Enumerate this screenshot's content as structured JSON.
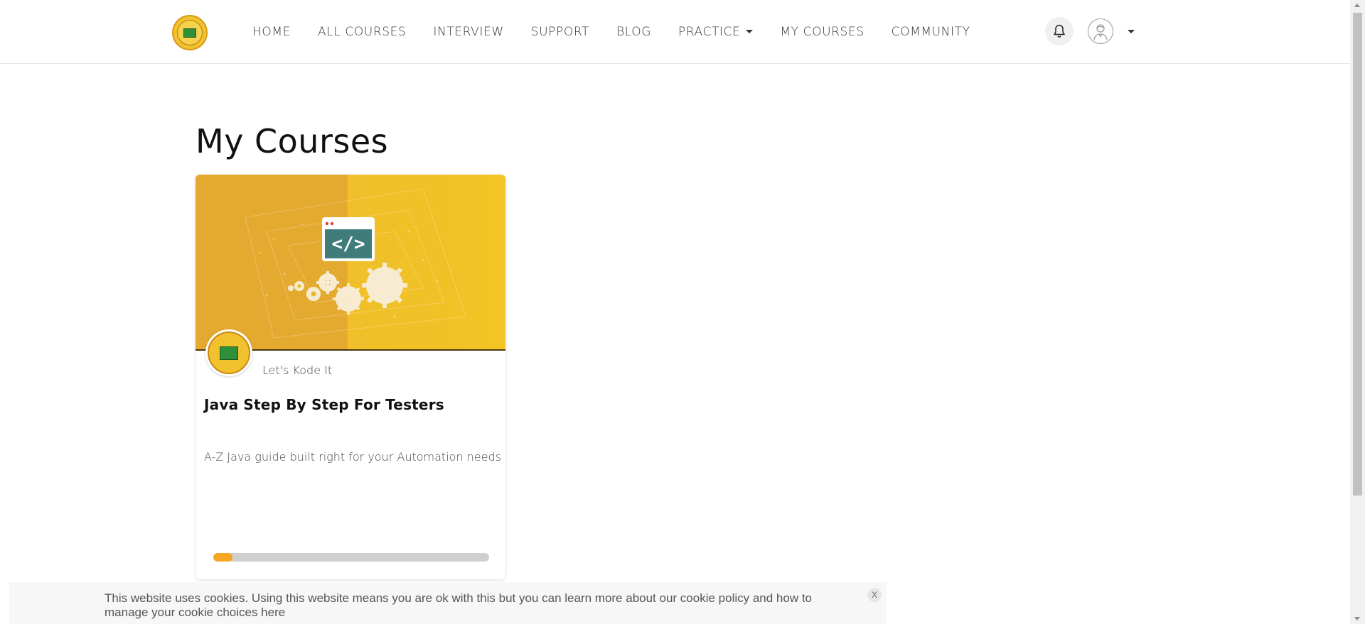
{
  "nav": {
    "logo_icon": "lets-kode-it-logo",
    "items": [
      {
        "label": "HOME"
      },
      {
        "label": "ALL COURSES"
      },
      {
        "label": "INTERVIEW"
      },
      {
        "label": "SUPPORT"
      },
      {
        "label": "BLOG"
      },
      {
        "label": "PRACTICE",
        "has_dropdown": true
      },
      {
        "label": "MY COURSES"
      },
      {
        "label": "COMMUNITY"
      }
    ],
    "notification_icon": "bell-icon",
    "avatar_icon": "user-avatar-icon"
  },
  "main": {
    "title": "My Courses",
    "courses": [
      {
        "author": "Let's Kode It",
        "title": "Java Step By Step For Testers",
        "description": "A-Z Java guide built right for your Automation needs",
        "progress_fraction": 0.07,
        "image_icon": "code-gears-illustration"
      }
    ]
  },
  "cookie": {
    "text": "This website uses cookies. Using this website means you are ok with this but you can learn more about our cookie policy and how to manage your cookie choices here",
    "close_label": "X"
  },
  "colors": {
    "accent": "#f5a623",
    "card_image_left": "#e4a92f",
    "card_image_right": "#f2c424"
  }
}
